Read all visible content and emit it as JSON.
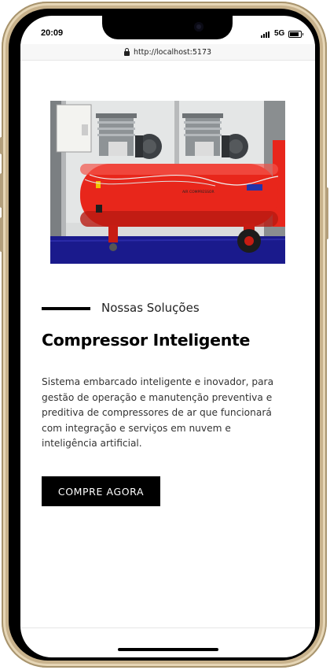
{
  "status_bar": {
    "time": "20:09",
    "network": "5G",
    "battery_level": 0.85
  },
  "browser": {
    "url": "http://localhost:5173"
  },
  "hero_image": {
    "subject": "two red air compressors on a blue floor",
    "tank_label": "AIR COMPRESSOR"
  },
  "section": {
    "label": "Nossas Soluções",
    "title": "Compressor Inteligente",
    "description": "Sistema embarcado inteligente e inovador, para gestão de operação e manutenção preventiva e preditiva de compressores de ar que funcionará com integração e serviços em nuvem e inteligência artificial."
  },
  "cta": {
    "label": "COMPRE AGORA"
  },
  "colors": {
    "accent": "#000000",
    "tank_red": "#e8261b",
    "floor_blue": "#1a1a8c",
    "frame_gold": "#c8b28c"
  }
}
